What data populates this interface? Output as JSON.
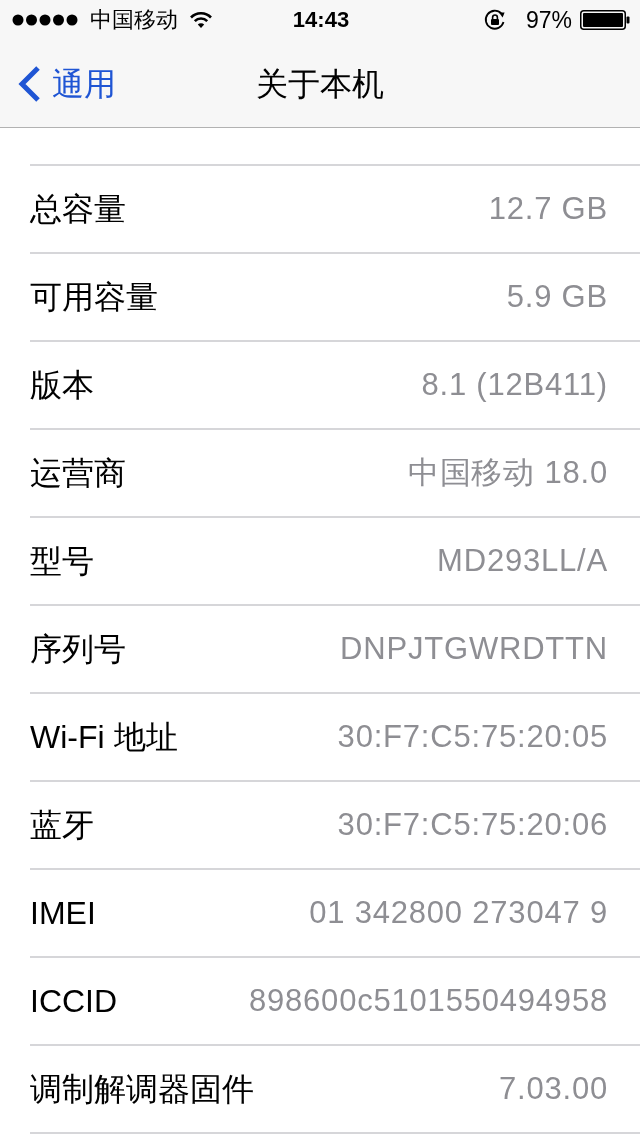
{
  "status_bar": {
    "carrier": "中国移动",
    "time": "14:43",
    "battery": "97%"
  },
  "nav_bar": {
    "back": "通用",
    "title": "关于本机"
  },
  "rows": [
    {
      "label": "总容量",
      "value": "12.7 GB"
    },
    {
      "label": "可用容量",
      "value": "5.9 GB"
    },
    {
      "label": "版本",
      "value": "8.1 (12B411)"
    },
    {
      "label": "运营商",
      "value": "中国移动 18.0"
    },
    {
      "label": "型号",
      "value": "MD293LL/A"
    },
    {
      "label": "序列号",
      "value": "DNPJTGWRDTTN"
    },
    {
      "label": "Wi-Fi 地址",
      "value": "30:F7:C5:75:20:05"
    },
    {
      "label": "蓝牙",
      "value": "30:F7:C5:75:20:06"
    },
    {
      "label": "IMEI",
      "value": "01 342800 273047 9"
    },
    {
      "label": "ICCID",
      "value": "898600c5101550494958"
    },
    {
      "label": "调制解调器固件",
      "value": "7.03.00"
    }
  ]
}
